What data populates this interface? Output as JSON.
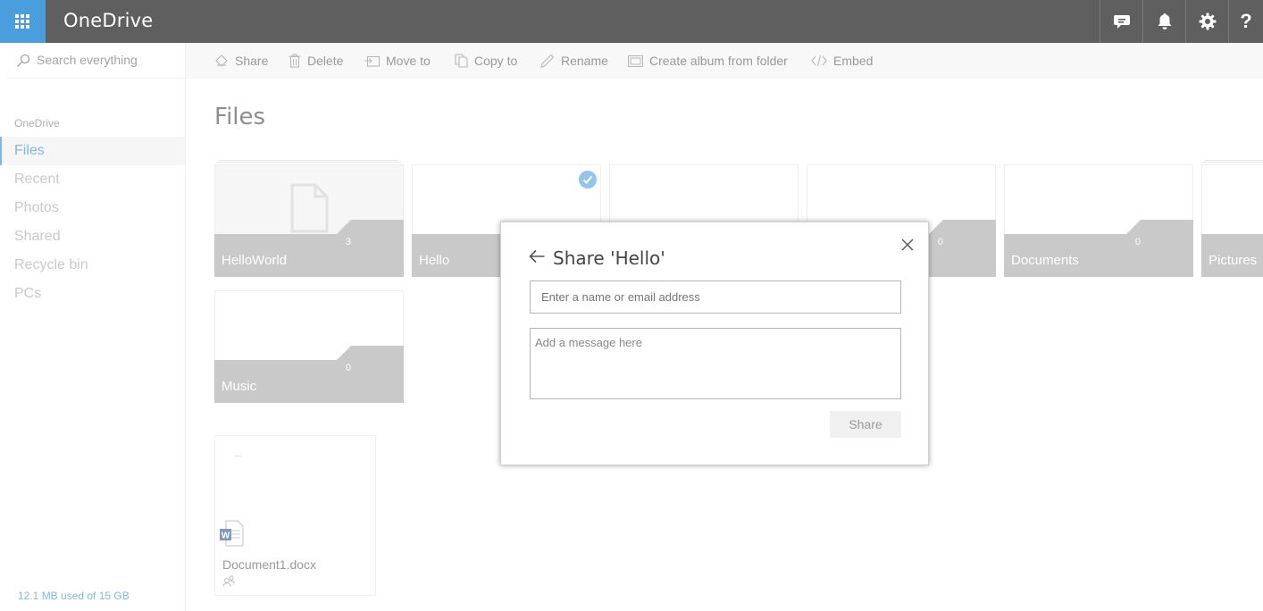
{
  "app": {
    "title": "OneDrive"
  },
  "topbar": {
    "icons": [
      "feedback-icon",
      "bell-icon",
      "gear-icon",
      "help-icon"
    ],
    "help_glyph": "?"
  },
  "search": {
    "placeholder": "Search everything"
  },
  "nav": {
    "heading": "OneDrive",
    "items": [
      {
        "label": "Files",
        "active": true
      },
      {
        "label": "Recent"
      },
      {
        "label": "Photos"
      },
      {
        "label": "Shared"
      },
      {
        "label": "Recycle bin"
      },
      {
        "label": "PCs"
      }
    ],
    "quota": "12.1 MB used of 15 GB"
  },
  "commands": [
    {
      "label": "Share",
      "icon": "share-icon"
    },
    {
      "label": "Delete",
      "icon": "trash-icon"
    },
    {
      "label": "Move to",
      "icon": "move-icon"
    },
    {
      "label": "Copy to",
      "icon": "copy-icon"
    },
    {
      "label": "Rename",
      "icon": "pencil-icon"
    },
    {
      "label": "Create album from folder",
      "icon": "album-icon"
    },
    {
      "label": "Embed",
      "icon": "embed-icon"
    }
  ],
  "main": {
    "title": "Files",
    "folders": [
      {
        "name": "HelloWorld",
        "count": "3"
      },
      {
        "name": "Hello",
        "selected": true
      },
      {
        "name": "",
        "count": ""
      },
      {
        "name": "",
        "count": "0"
      },
      {
        "name": "Documents",
        "count": "0"
      },
      {
        "name": "Pictures"
      },
      {
        "name": "Music",
        "count": "0"
      }
    ],
    "files": [
      {
        "name": "Document1.docx",
        "icon": "word-doc-icon",
        "status_icon": "shared-people-icon"
      }
    ]
  },
  "dialog": {
    "title": "Share 'Hello'",
    "recipient_placeholder": "Enter a name or email address",
    "message_placeholder": "Add a message here",
    "share_label": "Share"
  },
  "colors": {
    "accent": "#2b88d8",
    "topbar": "#5f5f5f",
    "waffle": "#4a9ede",
    "tile_band": "#a6a6a6"
  }
}
